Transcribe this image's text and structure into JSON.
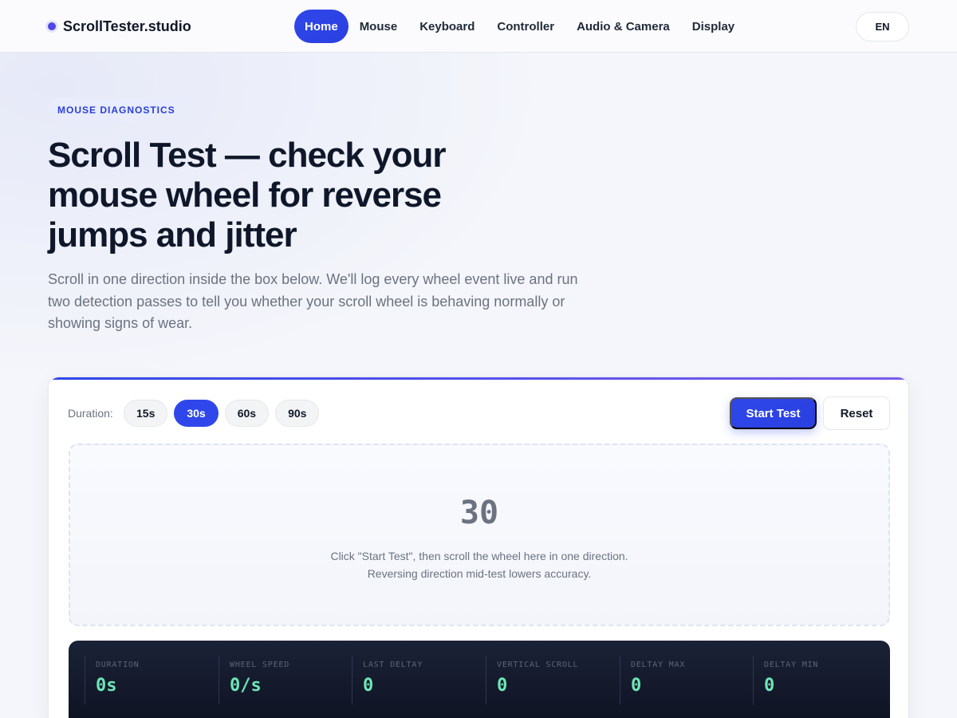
{
  "header": {
    "brand": "ScrollTester.studio",
    "nav": [
      {
        "label": "Home",
        "active": true
      },
      {
        "label": "Mouse",
        "active": false
      },
      {
        "label": "Keyboard",
        "active": false
      },
      {
        "label": "Controller",
        "active": false
      },
      {
        "label": "Audio & Camera",
        "active": false
      },
      {
        "label": "Display",
        "active": false
      }
    ],
    "language": "EN"
  },
  "hero": {
    "eyebrow": "MOUSE DIAGNOSTICS",
    "title": "Scroll Test — check your mouse wheel for reverse jumps and jitter",
    "subtitle": "Scroll in one direction inside the box below. We'll log every wheel event live and run two detection passes to tell you whether your scroll wheel is behaving normally or showing signs of wear."
  },
  "test": {
    "duration_label": "Duration:",
    "durations": [
      "15s",
      "30s",
      "60s",
      "90s"
    ],
    "selected_duration": "30s",
    "start_label": "Start Test",
    "reset_label": "Reset",
    "countdown": "30",
    "hint_line1": "Click \"Start Test\", then scroll the wheel here in one direction.",
    "hint_line2": "Reversing direction mid-test lowers accuracy."
  },
  "stats": [
    {
      "label": "DURATION",
      "value": "0s"
    },
    {
      "label": "WHEEL SPEED",
      "value": "0/s"
    },
    {
      "label": "LAST DELTAY",
      "value": "0"
    },
    {
      "label": "VERTICAL SCROLL",
      "value": "0"
    },
    {
      "label": "DELTAY MAX",
      "value": "0"
    },
    {
      "label": "DELTAY MIN",
      "value": "0"
    }
  ],
  "colors": {
    "accent": "#2f47ea",
    "stat_value": "#6ee7b7",
    "stats_bg": "#111827"
  }
}
